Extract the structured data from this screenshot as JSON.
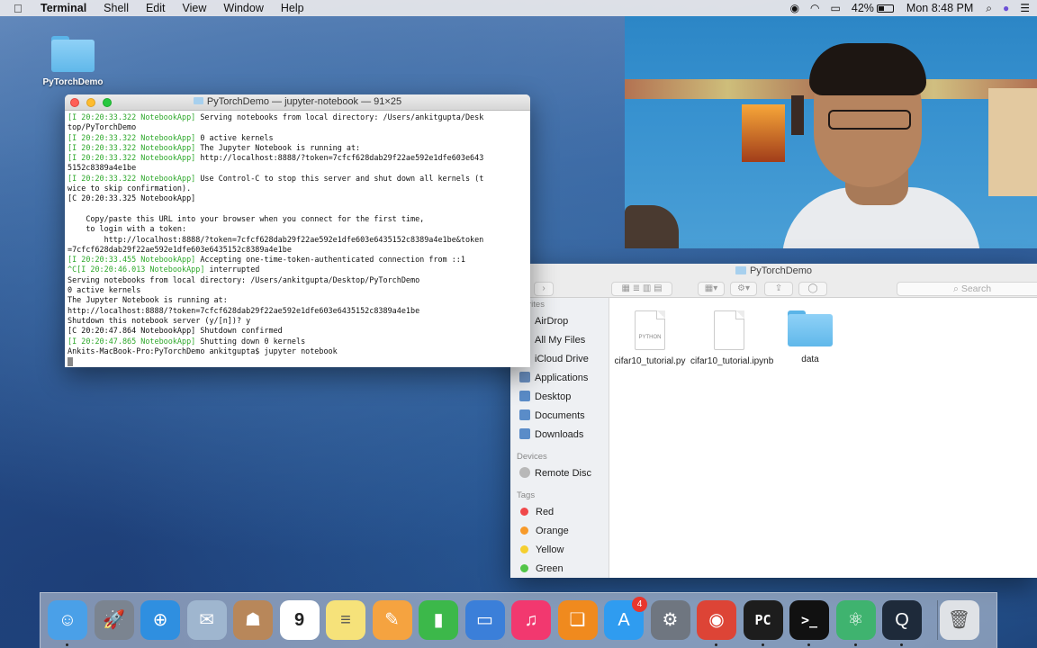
{
  "menubar": {
    "app_name": "Terminal",
    "menus": [
      "Shell",
      "Edit",
      "View",
      "Window",
      "Help"
    ],
    "battery_percent": "42%",
    "battery_level": 0.42,
    "clock": "Mon 8:48 PM"
  },
  "desktop": {
    "folder_label": "PyTorchDemo"
  },
  "terminal": {
    "title": "PyTorchDemo — jupyter-notebook — 91×25",
    "lines": [
      {
        "prefix": "[I 20:20:33.322 NotebookApp]",
        "text": " Serving notebooks from local directory: /Users/ankitgupta/Desk"
      },
      {
        "prefix": "",
        "text": "top/PyTorchDemo"
      },
      {
        "prefix": "[I 20:20:33.322 NotebookApp]",
        "text": " 0 active kernels"
      },
      {
        "prefix": "[I 20:20:33.322 NotebookApp]",
        "text": " The Jupyter Notebook is running at:"
      },
      {
        "prefix": "[I 20:20:33.322 NotebookApp]",
        "text": " http://localhost:8888/?token=7cfcf628dab29f22ae592e1dfe603e643"
      },
      {
        "prefix": "",
        "text": "5152c8389a4e1be"
      },
      {
        "prefix": "[I 20:20:33.322 NotebookApp]",
        "text": " Use Control-C to stop this server and shut down all kernels (t"
      },
      {
        "prefix": "",
        "text": "wice to skip confirmation)."
      },
      {
        "prefix": "",
        "text": "[C 20:20:33.325 NotebookApp]"
      },
      {
        "prefix": "",
        "text": ""
      },
      {
        "prefix": "",
        "text": "    Copy/paste this URL into your browser when you connect for the first time,"
      },
      {
        "prefix": "",
        "text": "    to login with a token:"
      },
      {
        "prefix": "",
        "text": "        http://localhost:8888/?token=7cfcf628dab29f22ae592e1dfe603e6435152c8389a4e1be&token"
      },
      {
        "prefix": "",
        "text": "=7cfcf628dab29f22ae592e1dfe603e6435152c8389a4e1be"
      },
      {
        "prefix": "[I 20:20:33.455 NotebookApp]",
        "text": " Accepting one-time-token-authenticated connection from ::1"
      },
      {
        "prefix": "^C[I 20:20:46.013 NotebookApp]",
        "text": " interrupted"
      },
      {
        "prefix": "",
        "text": "Serving notebooks from local directory: /Users/ankitgupta/Desktop/PyTorchDemo"
      },
      {
        "prefix": "",
        "text": "0 active kernels"
      },
      {
        "prefix": "",
        "text": "The Jupyter Notebook is running at:"
      },
      {
        "prefix": "",
        "text": "http://localhost:8888/?token=7cfcf628dab29f22ae592e1dfe603e6435152c8389a4e1be"
      },
      {
        "prefix": "",
        "text": "Shutdown this notebook server (y/[n])? y"
      },
      {
        "prefix": "",
        "text": "[C 20:20:47.864 NotebookApp] Shutdown confirmed"
      },
      {
        "prefix": "[I 20:20:47.865 NotebookApp]",
        "text": " Shutting down 0 kernels"
      },
      {
        "prefix": "",
        "text": "Ankits-MacBook-Pro:PyTorchDemo ankitgupta$ jupyter notebook"
      }
    ]
  },
  "finder": {
    "title": "PyTorchDemo",
    "search_placeholder": "Search",
    "favorites_header": "rites",
    "favorites": [
      {
        "label": "AirDrop",
        "icon": "airdrop-icon",
        "color": "#3a8ee6"
      },
      {
        "label": "All My Files",
        "icon": "all-files-icon",
        "color": "#8aa6c8"
      },
      {
        "label": "iCloud Drive",
        "icon": "icloud-icon",
        "color": "#5aa0e0"
      },
      {
        "label": "Applications",
        "icon": "applications-icon",
        "color": "#6a8fc0"
      },
      {
        "label": "Desktop",
        "icon": "desktop-icon",
        "color": "#5a8cc8"
      },
      {
        "label": "Documents",
        "icon": "documents-icon",
        "color": "#5a8cc8"
      },
      {
        "label": "Downloads",
        "icon": "downloads-icon",
        "color": "#5a8cc8"
      }
    ],
    "devices_header": "Devices",
    "devices": [
      {
        "label": "Remote Disc",
        "icon": "disc-icon",
        "color": "#b8b8b8"
      }
    ],
    "tags_header": "Tags",
    "tags": [
      {
        "label": "Red",
        "color": "#f0484a"
      },
      {
        "label": "Orange",
        "color": "#f79a2a"
      },
      {
        "label": "Yellow",
        "color": "#f5cf2f"
      },
      {
        "label": "Green",
        "color": "#52c548"
      }
    ],
    "files": [
      {
        "name": "cifar10_tutorial.py",
        "kind": "python",
        "badge": "PYTHON"
      },
      {
        "name": "cifar10_tutorial.ipynb",
        "kind": "doc",
        "badge": ""
      },
      {
        "name": "data",
        "kind": "folder",
        "badge": ""
      }
    ]
  },
  "dock": {
    "items": [
      {
        "name": "finder",
        "icon": "finder-icon",
        "bg": "#4aa0e8",
        "glyph": "☺",
        "running": true
      },
      {
        "name": "launchpad",
        "icon": "launchpad-icon",
        "bg": "#7b8490",
        "glyph": "🚀",
        "running": false
      },
      {
        "name": "safari",
        "icon": "safari-icon",
        "bg": "#2f8fe0",
        "glyph": "⊕",
        "running": false
      },
      {
        "name": "mail",
        "icon": "mail-icon",
        "bg": "#9fb6cf",
        "glyph": "✉",
        "running": false
      },
      {
        "name": "contacts",
        "icon": "contacts-icon",
        "bg": "#b8875a",
        "glyph": "☗",
        "running": false
      },
      {
        "name": "calendar",
        "icon": "calendar-icon",
        "bg": "#ffffff",
        "glyph": "9",
        "running": false
      },
      {
        "name": "notes",
        "icon": "notes-icon",
        "bg": "#f6e27a",
        "glyph": "≡",
        "running": false
      },
      {
        "name": "pages",
        "icon": "pages-icon",
        "bg": "#f5a340",
        "glyph": "✎",
        "running": false
      },
      {
        "name": "numbers",
        "icon": "numbers-icon",
        "bg": "#3cb84a",
        "glyph": "▮",
        "running": false
      },
      {
        "name": "keynote",
        "icon": "keynote-icon",
        "bg": "#3b7fd9",
        "glyph": "▭",
        "running": false
      },
      {
        "name": "itunes",
        "icon": "music-icon",
        "bg": "#f2386f",
        "glyph": "♫",
        "running": false
      },
      {
        "name": "ibooks",
        "icon": "books-icon",
        "bg": "#f08a1e",
        "glyph": "❏",
        "running": false
      },
      {
        "name": "app-store",
        "icon": "app-store-icon",
        "bg": "#2f9cf0",
        "glyph": "A",
        "badge": "4",
        "running": false
      },
      {
        "name": "system-preferences",
        "icon": "gear-icon",
        "bg": "#6f7680",
        "glyph": "⚙",
        "running": false
      },
      {
        "name": "chrome",
        "icon": "chrome-icon",
        "bg": "#dd4436",
        "glyph": "◉",
        "running": true
      },
      {
        "name": "pycharm",
        "icon": "pycharm-icon",
        "bg": "#1d1d1d",
        "glyph": "PC",
        "running": true
      },
      {
        "name": "terminal",
        "icon": "terminal-icon",
        "bg": "#111111",
        "glyph": ">_",
        "running": true
      },
      {
        "name": "atom",
        "icon": "atom-icon",
        "bg": "#3fb36f",
        "glyph": "⚛",
        "running": true
      },
      {
        "name": "quicktime",
        "icon": "quicktime-icon",
        "bg": "#1e2a3a",
        "glyph": "Q",
        "running": true
      },
      {
        "name": "trash",
        "icon": "trash-icon",
        "bg": "#dfe2e6",
        "glyph": "🗑",
        "running": false
      }
    ]
  }
}
